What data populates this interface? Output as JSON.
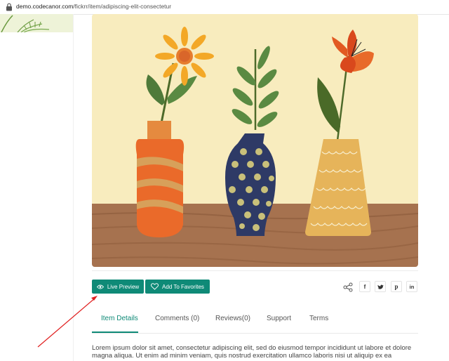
{
  "browser": {
    "url_host": "demo.codecanor.com",
    "url_path": "/fickrr/item/adipiscing-elit-consectetur"
  },
  "actions": {
    "live_preview_label": "Live Preview",
    "add_favorites_label": "Add To Favorites"
  },
  "social": {
    "facebook": "f",
    "twitter": "t",
    "pinterest": "p",
    "linkedin": "in"
  },
  "tabs": [
    {
      "label": "Item Details",
      "active": true
    },
    {
      "label": "Comments (0)"
    },
    {
      "label": "Reviews(0)"
    },
    {
      "label": "Support"
    },
    {
      "label": "Terms"
    }
  ],
  "description": "Lorem ipsum dolor sit amet, consectetur adipiscing elit, sed do eiusmod tempor incididunt ut labore et dolore magna aliqua. Ut enim ad minim veniam, quis nostrud exercitation ullamco laboris nisi ut aliquip ex ea",
  "colors": {
    "accent": "#0f8a77",
    "annotation_arrow": "#e02020"
  }
}
